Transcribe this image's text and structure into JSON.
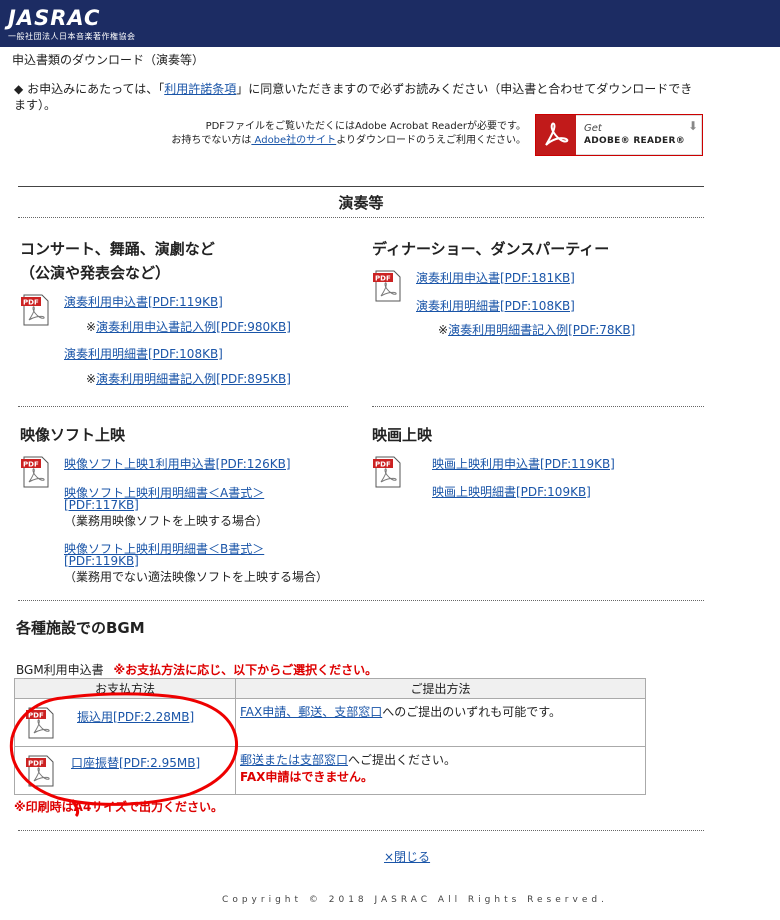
{
  "header": {
    "logo": "JASRAC",
    "logo_sub": "一般社団法人日本音楽著作権協会"
  },
  "page_title": "申込書類のダウンロード（演奏等）",
  "notice": {
    "bullet": "◆",
    "text_before": "お申込みにあたっては、「",
    "link": "利用許諾条項",
    "text_after": "」に同意いただきますので必ずお読みください（申込書と合わせてダウンロードできます）。"
  },
  "pdf_note": {
    "line1": "PDFファイルをご覧いただくにはAdobe Acrobat Readerが必要です。",
    "line2_before": "お持ちでない方は",
    "line2_link": " Adobe社のサイト",
    "line2_after": "よりダウンロードのうえご利用ください。"
  },
  "adobe_badge": {
    "get": "Get",
    "reader": "ADOBE® READER®"
  },
  "section_title": "演奏等",
  "concert": {
    "title1": "コンサート、舞踊、演劇など",
    "title2": "（公演や発表会など）",
    "link1": "演奏利用申込書[PDF:119KB]",
    "ex1_prefix": "※",
    "ex1": "演奏利用申込書記入例[PDF:980KB]",
    "link2": "演奏利用明細書[PDF:108KB]",
    "ex2_prefix": "※",
    "ex2": "演奏利用明細書記入例[PDF:895KB]"
  },
  "dinner": {
    "title": "ディナーショー、ダンスパーティー",
    "link1": "演奏利用申込書[PDF:181KB]",
    "link2": "演奏利用明細書[PDF:108KB]",
    "ex_prefix": "※",
    "ex": "演奏利用明細書記入例[PDF:78KB]"
  },
  "video": {
    "title": "映像ソフト上映",
    "link1": "映像ソフト上映1利用申込書[PDF:126KB]",
    "link2a": "映像ソフト上映利用明細書＜A書式＞",
    "link2b": "[PDF:117KB]",
    "note2": "（業務用映像ソフトを上映する場合）",
    "link3a": "映像ソフト上映利用明細書＜B書式＞",
    "link3b": "[PDF:119KB]",
    "note3": "（業務用でない適法映像ソフトを上映する場合）"
  },
  "movie": {
    "title": "映画上映",
    "link1": "映画上映利用申込書[PDF:119KB]",
    "link2": "映画上映明細書[PDF:109KB]"
  },
  "bgm": {
    "title": "各種施設でのBGM",
    "label": "BGM利用申込書",
    "label_note": "※お支払方法に応じ、以下からご選択ください。",
    "col1": "お支払方法",
    "col2": "ご提出方法",
    "row1_link": "振込用[PDF:2.28MB]",
    "row1_desc_link": "FAX申請、郵送、支部窓口",
    "row1_desc": "へのご提出のいずれも可能です。",
    "row2_link": "口座振替[PDF:2.95MB]",
    "row2_desc_link": "郵送または支部窓口",
    "row2_desc": "へご提出ください。",
    "row2_warn": "FAX申請はできません。",
    "print_note": "※印刷時はA4サイズで出力ください。"
  },
  "close": "×閉じる",
  "copyright": "Copyright © 2018 JASRAC All Rights Reserved.",
  "colors": {
    "header_bg": "#1c2c63",
    "link": "#1a55a8",
    "warning": "#dd0000",
    "annotation": "#e00000"
  }
}
